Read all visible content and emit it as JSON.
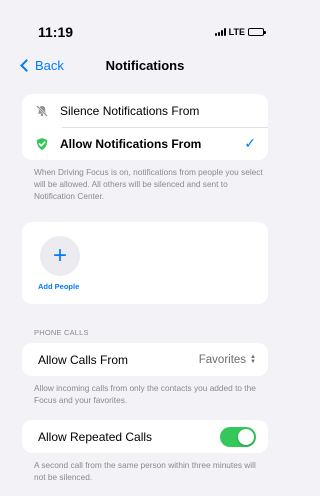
{
  "status_bar": {
    "time": "11:19",
    "network": "LTE"
  },
  "nav": {
    "back_label": "Back",
    "title": "Notifications"
  },
  "mode_options": [
    {
      "label": "Silence Notifications From",
      "icon": "muted-bell-icon",
      "selected": false
    },
    {
      "label": "Allow Notifications From",
      "icon": "green-shield-check-icon",
      "selected": true
    }
  ],
  "mode_footer": "When Driving Focus is on, notifications from people you select will be allowed. All others will be silenced and sent to Notification Center.",
  "add_people": {
    "label": "Add People",
    "icon": "plus-icon"
  },
  "phone_calls": {
    "header": "PHONE CALLS",
    "allow_calls_label": "Allow Calls From",
    "allow_calls_value": "Favorites",
    "allow_calls_footer": "Allow incoming calls from only the contacts you added to the Focus and your favorites.",
    "repeated_calls_label": "Allow Repeated Calls",
    "repeated_calls_enabled": true,
    "repeated_calls_footer": "A second call from the same person within three minutes will not be silenced."
  },
  "colors": {
    "accent": "#007aff",
    "toggle_on": "#34c759",
    "shield": "#34c759"
  }
}
